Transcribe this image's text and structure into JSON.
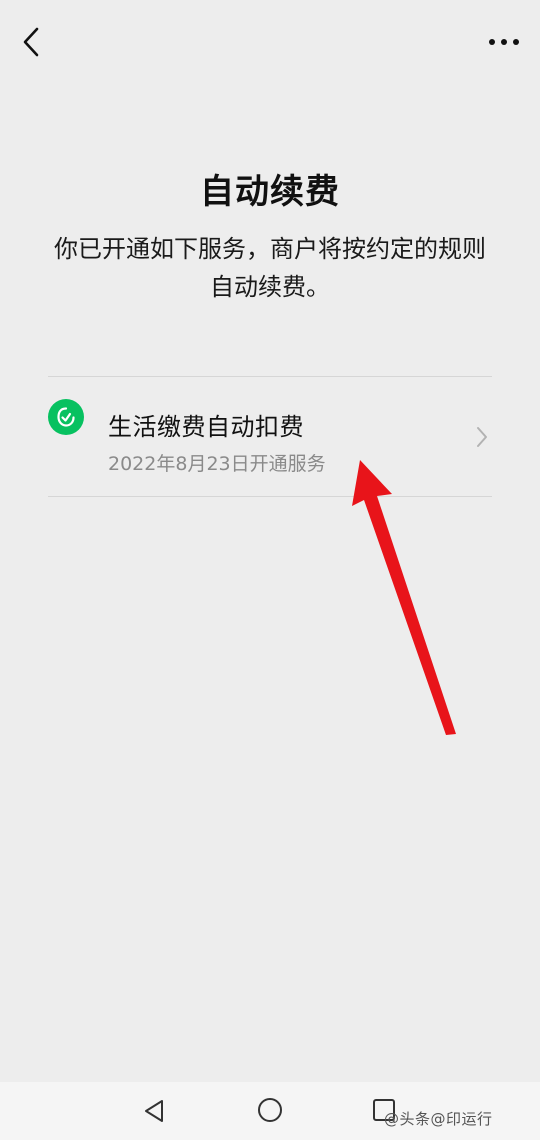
{
  "header": {
    "back_icon": "chevron-left-icon",
    "more_icon": "more-dots-icon"
  },
  "page": {
    "title": "自动续费",
    "description": "你已开通如下服务，商户将按约定的规则自动续费。"
  },
  "services": [
    {
      "icon": "wechat-pay-green-icon",
      "name": "生活缴费自动扣费",
      "date": "2022年8月23日开通服务"
    }
  ],
  "annotation": {
    "arrow_color": "#e8141a"
  },
  "navbar": {
    "back_icon": "triangle-back-icon",
    "home_icon": "circle-home-icon",
    "recent_icon": "square-recent-icon"
  },
  "watermark": "@头条@印运行",
  "colors": {
    "background": "#ededed",
    "accent_green": "#07c160",
    "secondary_text": "#8a8a8a"
  }
}
